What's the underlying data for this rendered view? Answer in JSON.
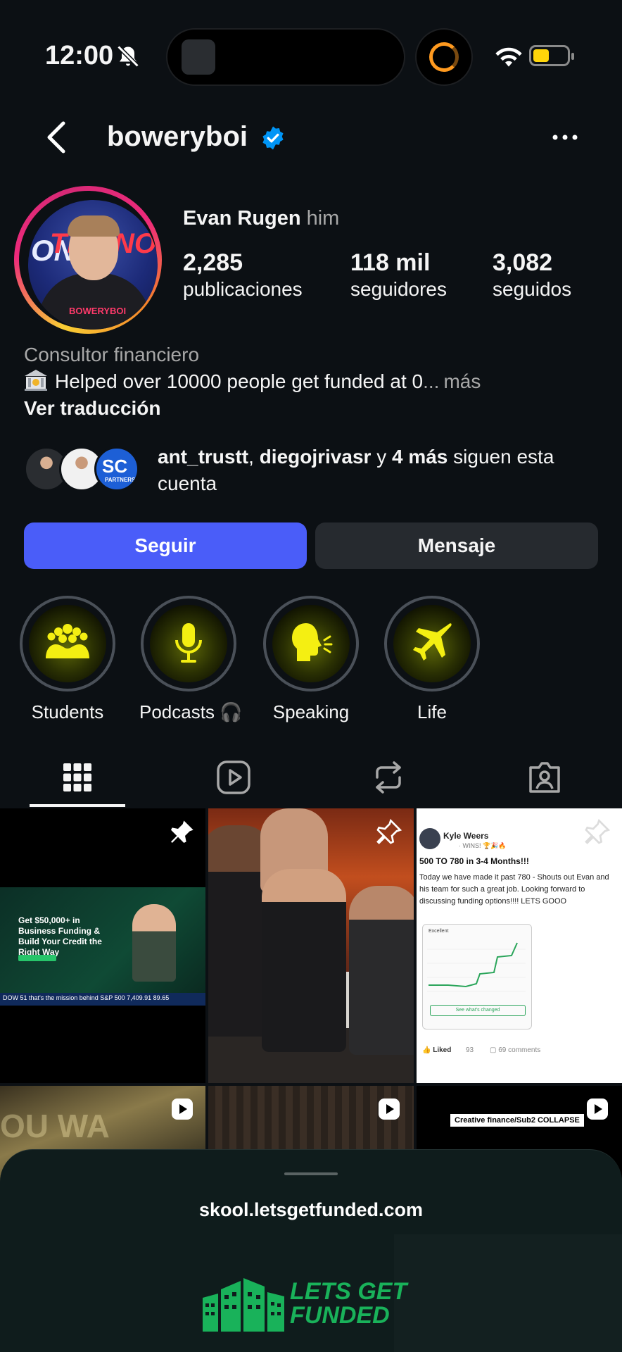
{
  "status_bar": {
    "time": "12:00"
  },
  "header": {
    "username": "boweryboi"
  },
  "profile": {
    "full_name": "Evan Rugen",
    "pronoun": "him",
    "stats": [
      {
        "value": "2,285",
        "label": "publicaciones"
      },
      {
        "value": "118 mil",
        "label": "seguidores"
      },
      {
        "value": "3,082",
        "label": "seguidos"
      }
    ],
    "category": "Consultor financiero",
    "bio_line": "Helped over 10000 people get funded at 0",
    "bio_ellipsis": "...",
    "bio_more": "más",
    "translate": "Ver traducción",
    "avatar_text_left": "ON",
    "avatar_text_right": "THE NO",
    "avatar_brand": "BOWERYBOI"
  },
  "followed_by": {
    "user1": "ant_trustt",
    "sep": ",",
    "user2": "diegojrivasr",
    "connector": "y",
    "more": "4 más",
    "suffix": "siguen esta cuenta",
    "badge_text": "SC",
    "badge_sub": "PARTNERS"
  },
  "actions": {
    "follow": "Seguir",
    "message": "Mensaje"
  },
  "highlights": [
    {
      "label": "Students",
      "icon": "crowd-icon"
    },
    {
      "label": "Podcasts 🎧",
      "icon": "microphone-icon"
    },
    {
      "label": "Speaking",
      "icon": "speaking-head-icon"
    },
    {
      "label": "Life",
      "icon": "airplane-icon"
    }
  ],
  "tabs": [
    "grid-icon",
    "reels-icon",
    "reposts-icon",
    "tagged-icon"
  ],
  "posts": {
    "p1": {
      "headline": "Get $50,000+ in Business Funding & Build Your Credit the Right Way",
      "ticker": "DOW  51  that's the mission behind  S&P 500  7,409.91  89.65"
    },
    "p3": {
      "author": "Kyle Weers",
      "tag": "· WINS! 🏆🎉🔥",
      "title": "500 TO 780 in 3-4 Months!!!",
      "body": "Today we have made it past 780 - Shouts out Evan and his team for such a great job. Looking forward to discussing funding options!!!! LETS GOOO",
      "card_label": "Excellent",
      "card_button": "See what's changed",
      "liked": "Liked",
      "likes": "93",
      "comments": "69 comments"
    },
    "p4": {
      "text": "OU WA"
    },
    "p6": {
      "caption": "Creative finance/Sub2 COLLAPSE"
    }
  },
  "sheet": {
    "url": "skool.letsgetfunded.com",
    "logo_line1": "LETS GET",
    "logo_line2": "FUNDED"
  },
  "colors": {
    "background": "#0c1014",
    "follow_button": "#4a5df9",
    "message_button": "#262a2f",
    "verified": "#0095f6",
    "logo_green": "#19b25a",
    "highlight_yellow": "#f4ef12"
  }
}
